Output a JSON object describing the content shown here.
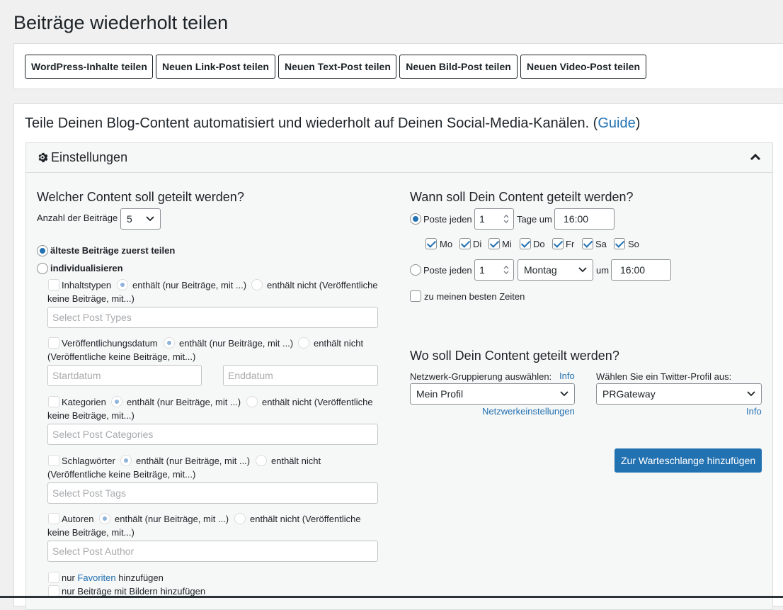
{
  "page_title": "Beiträge wiederholt teilen",
  "toolbar": {
    "buttons": [
      "WordPress-Inhalte teilen",
      "Neuen Link-Post teilen",
      "Neuen Text-Post teilen",
      "Neuen Bild-Post teilen",
      "Neuen Video-Post teilen"
    ]
  },
  "intro": {
    "text": "Teile Deinen Blog-Content automatisiert und wiederholt auf Deinen Social-Media-Kanälen. (",
    "guide_link": "Guide",
    "close_paren": ")"
  },
  "settings": {
    "title": "Einstellungen",
    "content": {
      "heading": "Welcher Content soll geteilt werden?",
      "count_label": "Anzahl der Beiträge",
      "count_value": "5",
      "option_oldest": "älteste Beiträge zuerst teilen",
      "option_custom": "individualisieren",
      "filters": [
        {
          "label": "Inhaltstypen",
          "contains": "enthält (nur Beiträge, mit ...)",
          "not_contains": "enthält nicht (Veröffentliche",
          "continuation": "keine Beiträge, mit...)",
          "placeholder": "Select Post Types"
        },
        {
          "label": "Veröffentlichungsdatum",
          "contains": "enthält (nur Beiträge, mit ...)",
          "not_contains": "enthält nicht",
          "continuation": "(Veröffentliche keine Beiträge, mit...)",
          "placeholder_start": "Startdatum",
          "placeholder_end": "Enddatum"
        },
        {
          "label": "Kategorien",
          "contains": "enthält (nur Beiträge, mit ...)",
          "not_contains": "enthält nicht (Veröffentliche",
          "continuation": "keine Beiträge, mit...)",
          "placeholder": "Select Post Categories"
        },
        {
          "label": "Schlagwörter",
          "contains": "enthält (nur Beiträge, mit ...)",
          "not_contains": "enthält nicht",
          "continuation": "(Veröffentliche keine Beiträge, mit...)",
          "placeholder": "Select Post Tags"
        },
        {
          "label": "Autoren",
          "contains": "enthält (nur Beiträge, mit ...)",
          "not_contains": "enthält nicht (Veröffentliche",
          "continuation": "keine Beiträge, mit...)",
          "placeholder": "Select Post Author"
        }
      ],
      "favorites_prefix": "nur",
      "favorites_link": "Favoriten",
      "favorites_suffix": "hinzufügen",
      "images_only": "nur Beiträge mit Bildern hinzufügen"
    },
    "schedule": {
      "heading": "Wann soll Dein Content geteilt werden?",
      "post_every": "Poste jeden",
      "interval_value": "1",
      "days_label": "Tage um",
      "time1": "16:00",
      "days": [
        "Mo",
        "Di",
        "Mi",
        "Do",
        "Fr",
        "Sa",
        "So"
      ],
      "weekday_value": "1",
      "weekday_select": "Montag",
      "at_label": "um",
      "time2": "16:00",
      "best_times": "zu meinen besten Zeiten"
    },
    "where": {
      "heading": "Wo soll Dein Content geteilt werden?",
      "network_label": "Netzwerk-Gruppierung auswählen:",
      "network_info": "Info",
      "network_value": "Mein Profil",
      "network_settings_link": "Netzwerkeinstellungen",
      "twitter_label": "Wählen Sie ein Twitter-Profil aus:",
      "twitter_value": "PRGateway",
      "twitter_info": "Info",
      "submit": "Zur Warteschlange hinzufügen"
    }
  },
  "colors": {
    "accent": "#2271b1",
    "background": "#f0f0f1",
    "panel": "#f6f7f7"
  }
}
